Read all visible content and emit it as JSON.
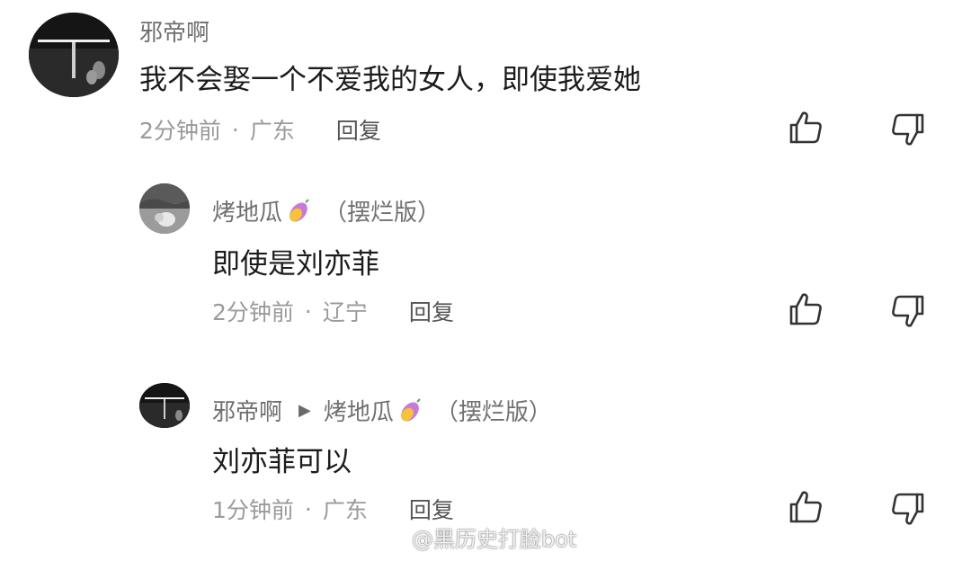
{
  "comments": [
    {
      "username": "邪帝啊",
      "text": "我不会娶一个不爱我的女人，即使我爱她",
      "time": "2分钟前",
      "location": "广东",
      "reply_label": "回复"
    },
    {
      "username": "烤地瓜",
      "badge": "（摆烂版）",
      "text": "即使是刘亦菲",
      "time": "2分钟前",
      "location": "辽宁",
      "reply_label": "回复"
    },
    {
      "username": "邪帝啊",
      "reply_to": "烤地瓜",
      "badge": "（摆烂版）",
      "text": "刘亦菲可以",
      "time": "1分钟前",
      "location": "广东",
      "reply_label": "回复"
    }
  ],
  "meta_separator": "·",
  "reply_arrow": "▶",
  "icons": {
    "like": "thumbs-up-icon",
    "dislike": "thumbs-down-icon",
    "emoji": "sweet-potato-icon"
  },
  "watermark": "@黑历史打脸bot",
  "colors": {
    "username": "#707070",
    "text": "#1c1c1c",
    "meta": "#9a9a9a",
    "reply": "#555555"
  }
}
